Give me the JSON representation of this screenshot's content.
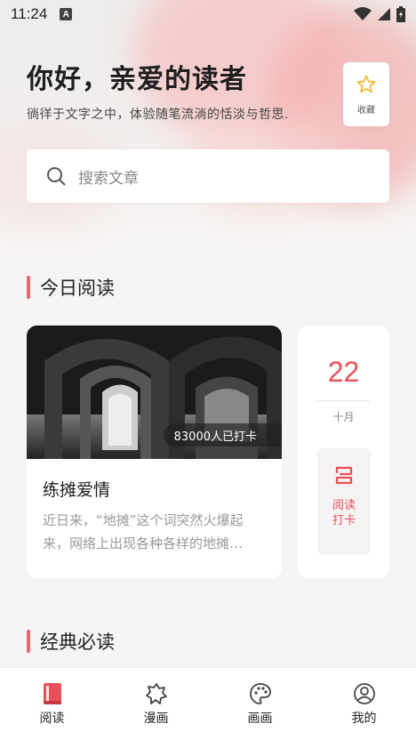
{
  "status": {
    "time": "11:24",
    "notification_icon": "A"
  },
  "header": {
    "greeting": "你好，亲爱的读者",
    "subtitle": "徜徉于文字之中，体验随笔流淌的恬淡与哲思.",
    "favorite_label": "收藏"
  },
  "search": {
    "placeholder": "搜索文章"
  },
  "today": {
    "section_title": "今日阅读",
    "article": {
      "checkin_count": "83000人已打卡",
      "title": "练摊爱情",
      "excerpt": "近日来，“地摊”这个词突然火爆起来，网络上出现各种各样的地摊…"
    },
    "date": {
      "day": "22",
      "month": "十月"
    },
    "checkin_label": "阅读打卡"
  },
  "classics": {
    "section_title": "经典必读"
  },
  "tabs": [
    {
      "label": "阅读",
      "icon": "book-icon",
      "active": true
    },
    {
      "label": "漫画",
      "icon": "comic-icon",
      "active": false
    },
    {
      "label": "画画",
      "icon": "palette-icon",
      "active": false
    },
    {
      "label": "我的",
      "icon": "profile-icon",
      "active": false
    }
  ],
  "colors": {
    "accent": "#e9505a",
    "star": "#f5b82e"
  }
}
